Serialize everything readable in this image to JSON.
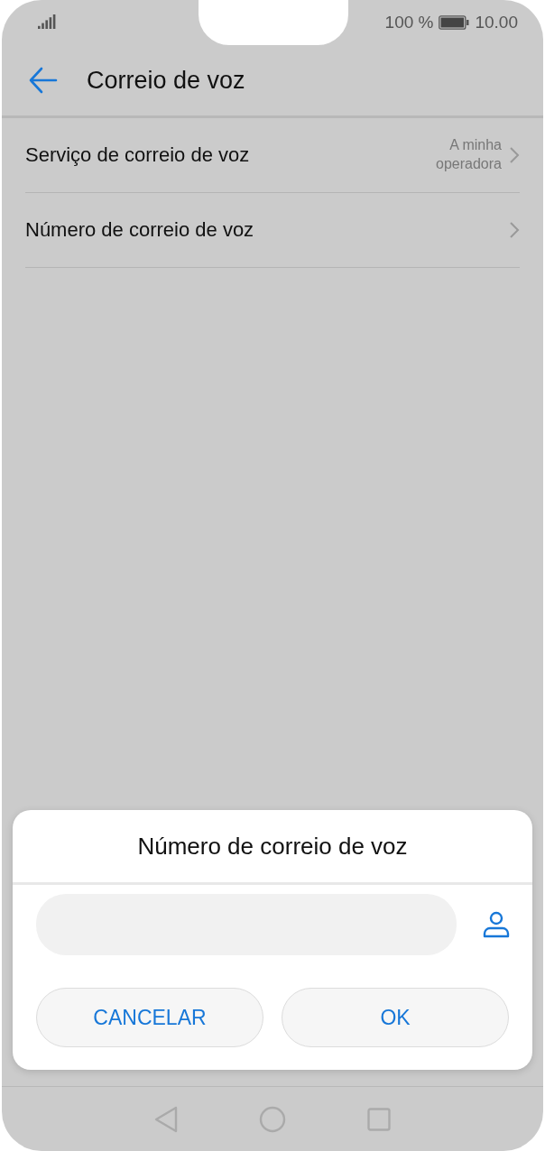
{
  "status_bar": {
    "battery": "100 %",
    "time": "10.00"
  },
  "app_bar": {
    "title": "Correio de voz"
  },
  "settings": [
    {
      "label": "Serviço de correio de voz",
      "value": "A minha operadora"
    },
    {
      "label": "Número de correio de voz"
    }
  ],
  "dialog": {
    "title": "Número de correio de voz",
    "buttons": [
      "CANCELAR",
      "OK"
    ]
  }
}
